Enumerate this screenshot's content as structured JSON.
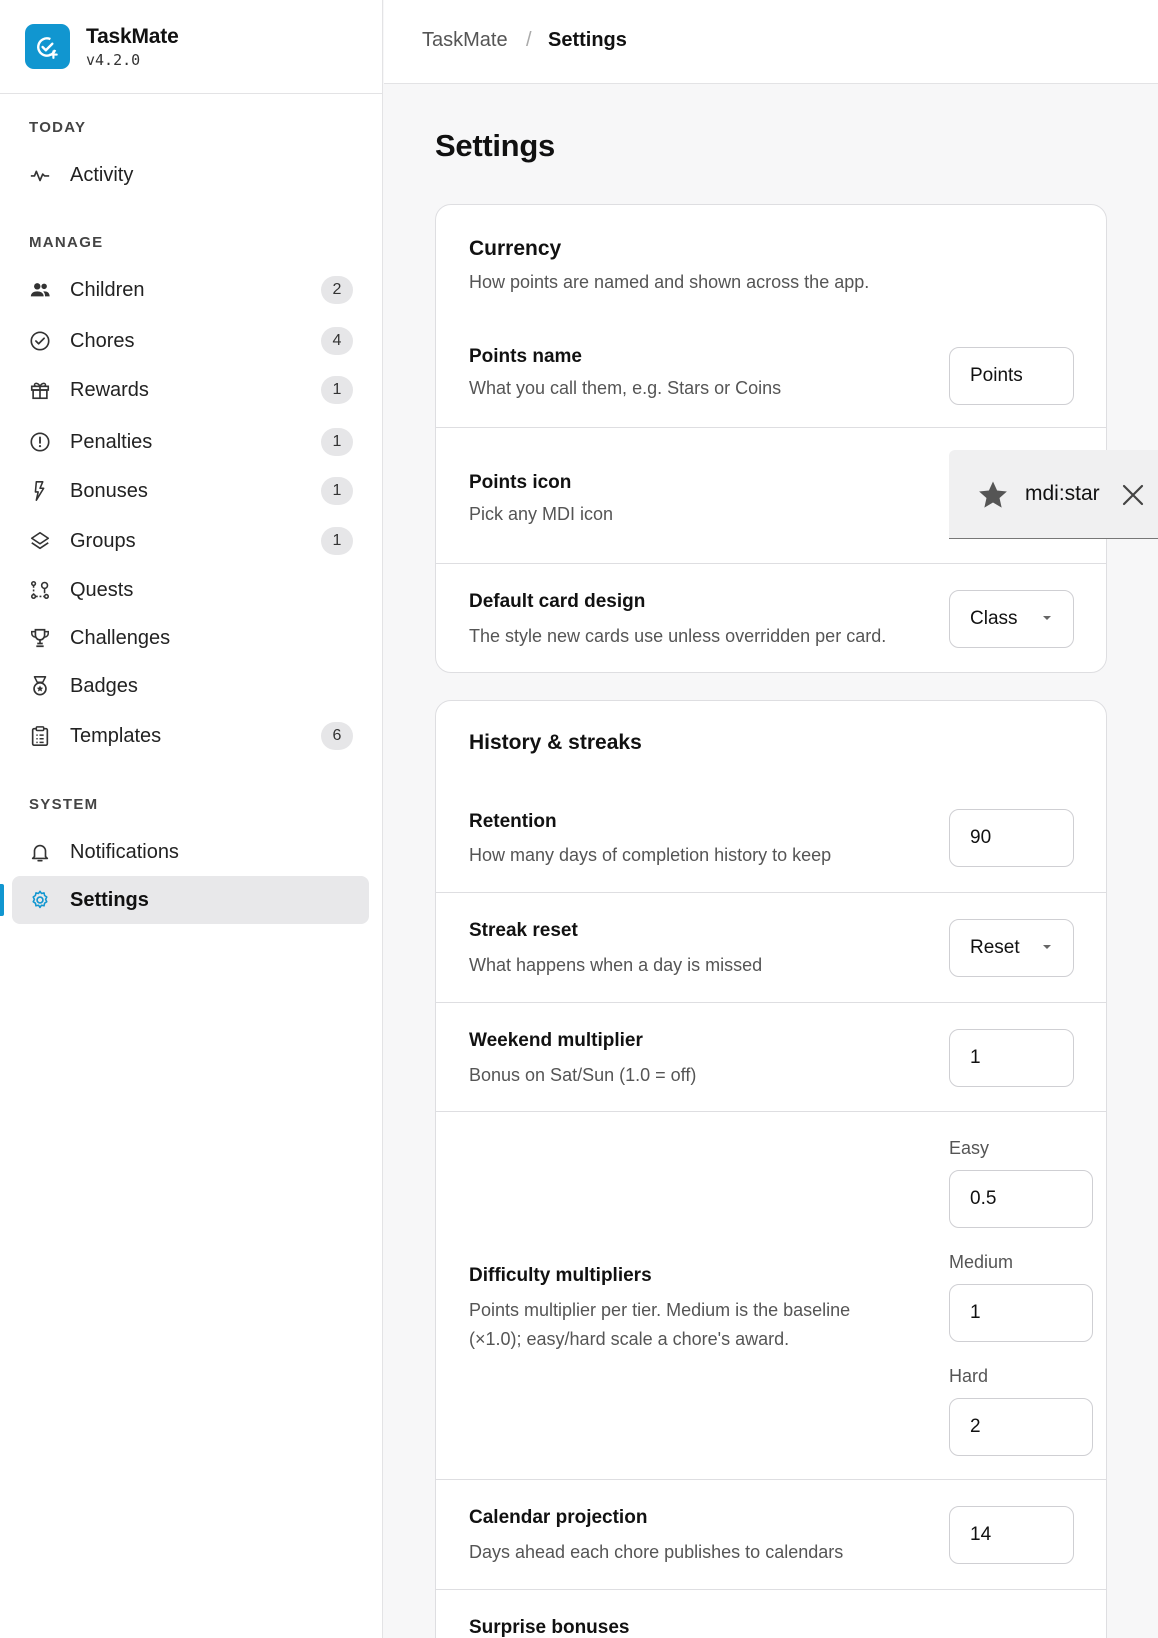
{
  "app": {
    "name": "TaskMate",
    "version": "v4.2.0"
  },
  "breadcrumb": {
    "root": "TaskMate",
    "separator": "/",
    "current": "Settings"
  },
  "sidebar": {
    "sections": {
      "today": "TODAY",
      "manage": "MANAGE",
      "system": "SYSTEM"
    },
    "items": {
      "activity": {
        "label": "Activity",
        "icon": "activity-icon"
      },
      "children": {
        "label": "Children",
        "badge": "2",
        "icon": "account-group-icon"
      },
      "chores": {
        "label": "Chores",
        "badge": "4",
        "icon": "check-circle-icon"
      },
      "rewards": {
        "label": "Rewards",
        "badge": "1",
        "icon": "gift-icon"
      },
      "penalties": {
        "label": "Penalties",
        "badge": "1",
        "icon": "alert-circle-icon"
      },
      "bonuses": {
        "label": "Bonuses",
        "badge": "1",
        "icon": "lightning-icon"
      },
      "groups": {
        "label": "Groups",
        "badge": "1",
        "icon": "layers-icon"
      },
      "quests": {
        "label": "Quests",
        "icon": "quest-path-icon"
      },
      "challenges": {
        "label": "Challenges",
        "icon": "trophy-icon"
      },
      "badges": {
        "label": "Badges",
        "icon": "medal-icon"
      },
      "templates": {
        "label": "Templates",
        "badge": "6",
        "icon": "clipboard-list-icon"
      },
      "notifications": {
        "label": "Notifications",
        "icon": "bell-icon"
      },
      "settings": {
        "label": "Settings",
        "icon": "gear-icon",
        "active": true
      }
    }
  },
  "page": {
    "title": "Settings"
  },
  "currency": {
    "title": "Currency",
    "subtitle": "How points are named and shown across the app.",
    "points_name": {
      "label": "Points name",
      "desc": "What you call them, e.g. Stars or Coins",
      "value": "Points"
    },
    "points_icon": {
      "label": "Points icon",
      "desc": "Pick any MDI icon",
      "value": "mdi:star",
      "icon": "star-icon"
    },
    "card_design": {
      "label": "Default card design",
      "desc": "The style new cards use unless overridden per card.",
      "value": "Class"
    }
  },
  "history": {
    "title": "History & streaks",
    "retention": {
      "label": "Retention",
      "desc": "How many days of completion history to keep",
      "value": "90"
    },
    "streak_reset": {
      "label": "Streak reset",
      "desc": "What happens when a day is missed",
      "value": "Reset"
    },
    "weekend": {
      "label": "Weekend multiplier",
      "desc": "Bonus on Sat/Sun (1.0 = off)",
      "value": "1"
    },
    "difficulty": {
      "label": "Difficulty multipliers",
      "desc_line1": "Points multiplier per tier. Medium is the baseline",
      "desc_line2": "(×1.0); easy/hard scale a chore's award.",
      "easy": {
        "label": "Easy",
        "value": "0.5"
      },
      "medium": {
        "label": "Medium",
        "value": "1"
      },
      "hard": {
        "label": "Hard",
        "value": "2"
      }
    },
    "calendar": {
      "label": "Calendar projection",
      "desc": "Days ahead each chore publishes to calendars",
      "value": "14"
    },
    "surprise": {
      "label": "Surprise bonuses"
    }
  },
  "colors": {
    "accent": "#1196d0",
    "active_bg": "#e8e8ea",
    "badge_bg": "#e6e6e8"
  }
}
